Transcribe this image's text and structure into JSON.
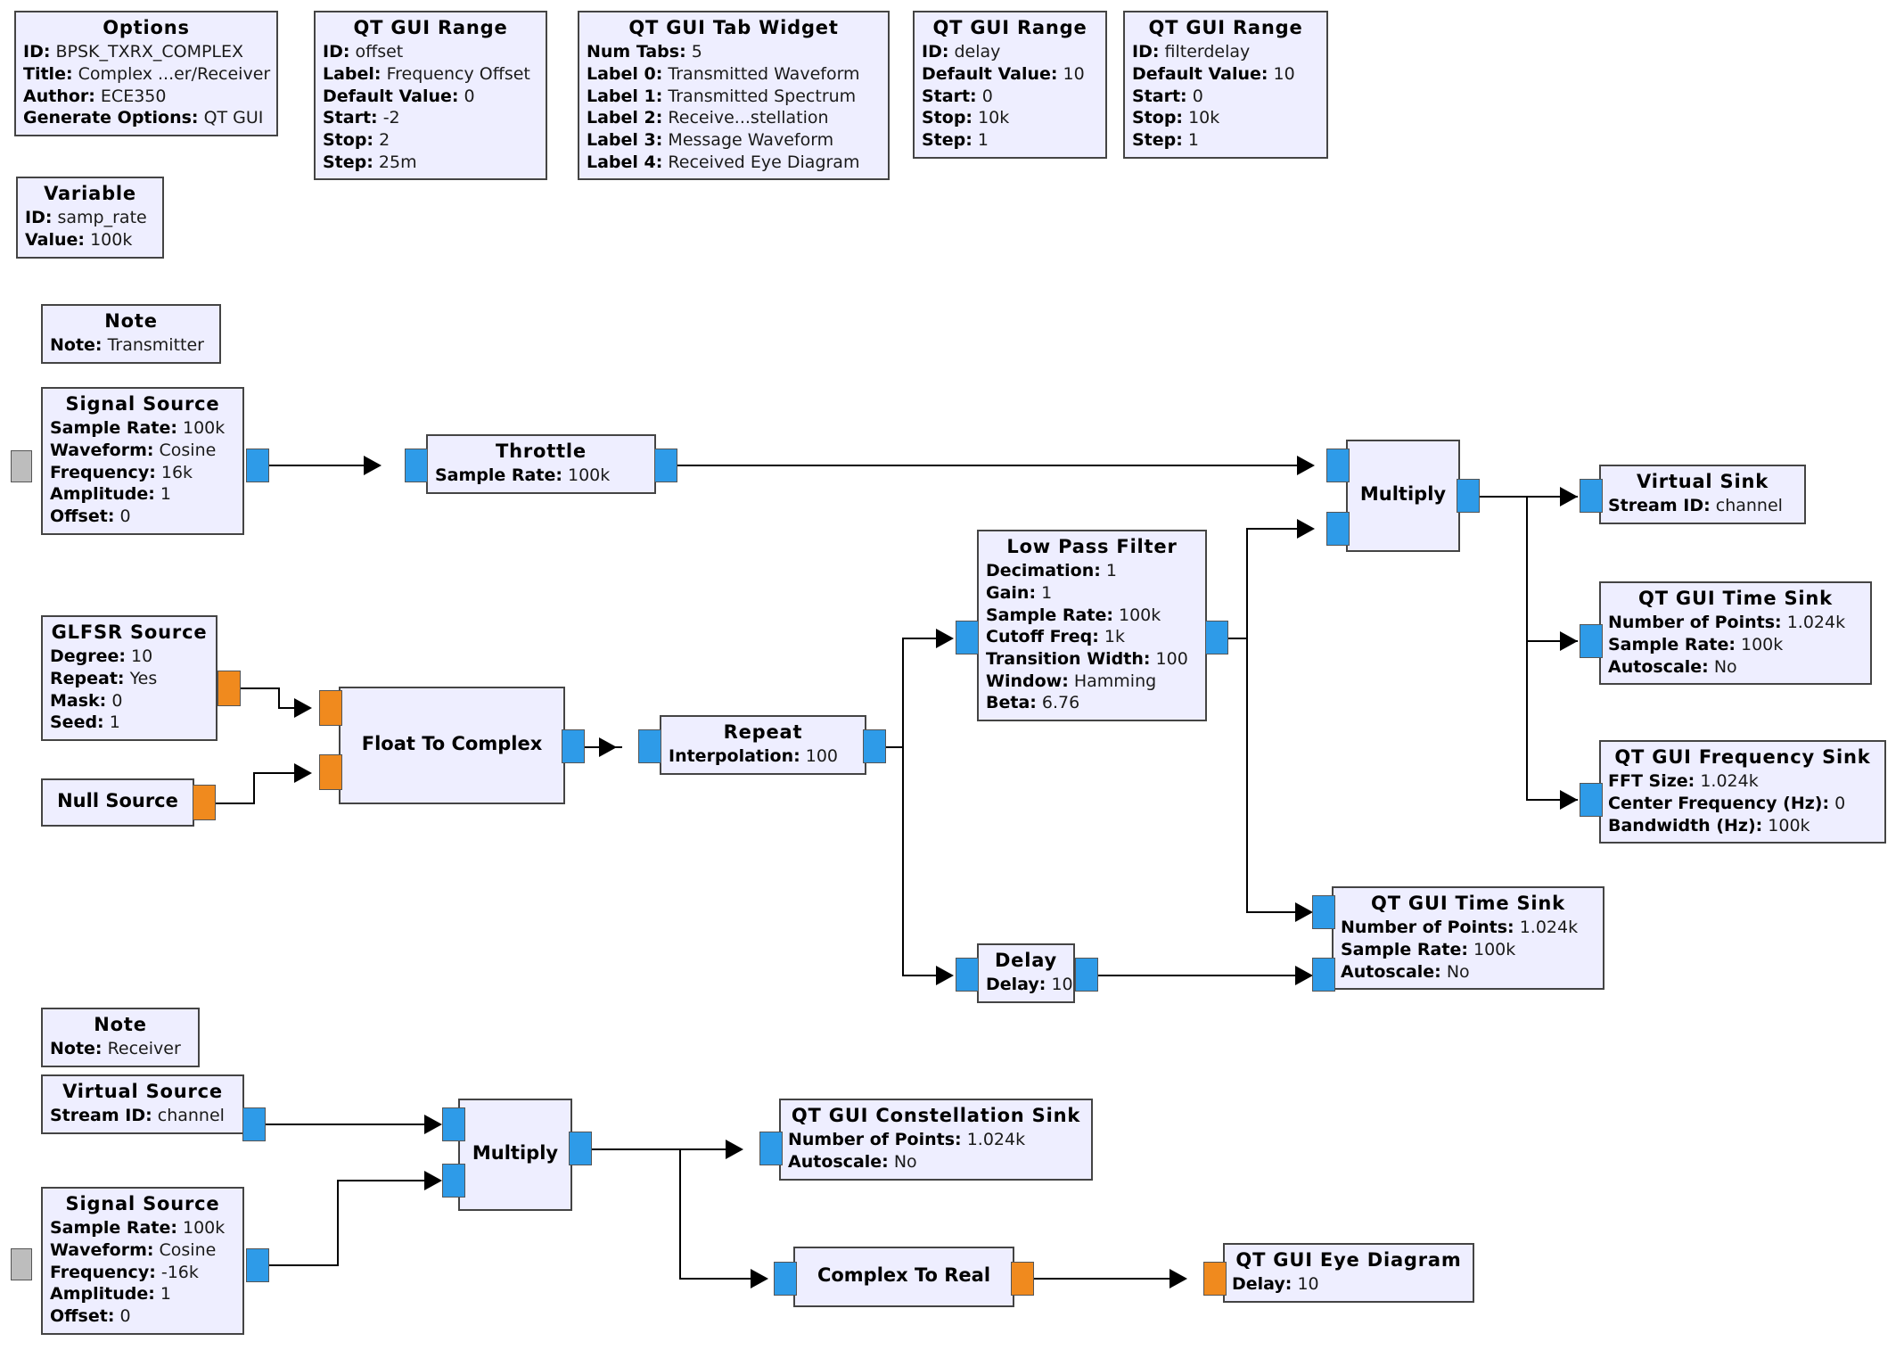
{
  "flowgraph": {
    "blocks": [
      {
        "key": "options",
        "title": "Options",
        "params": [
          {
            "label": "ID:",
            "value": "BPSK_TXRX_COMPLEX"
          },
          {
            "label": "Title:",
            "value": "Complex ...er/Receiver"
          },
          {
            "label": "Author:",
            "value": "ECE350"
          },
          {
            "label": "Generate Options:",
            "value": "QT GUI"
          }
        ]
      },
      {
        "key": "range-offset",
        "title": "QT GUI Range",
        "params": [
          {
            "label": "ID:",
            "value": "offset"
          },
          {
            "label": "Label:",
            "value": "Frequency Offset"
          },
          {
            "label": "Default Value:",
            "value": "0"
          },
          {
            "label": "Start:",
            "value": "-2"
          },
          {
            "label": "Stop:",
            "value": "2"
          },
          {
            "label": "Step:",
            "value": "25m"
          }
        ]
      },
      {
        "key": "tab-widget",
        "title": "QT GUI Tab Widget",
        "params": [
          {
            "label": "Num Tabs:",
            "value": "5"
          },
          {
            "label": "Label 0:",
            "value": "Transmitted Waveform"
          },
          {
            "label": "Label 1:",
            "value": "Transmitted Spectrum"
          },
          {
            "label": "Label 2:",
            "value": "Receive...stellation"
          },
          {
            "label": "Label 3:",
            "value": "Message Waveform"
          },
          {
            "label": "Label 4:",
            "value": "Received Eye Diagram"
          }
        ]
      },
      {
        "key": "range-delay",
        "title": "QT GUI Range",
        "params": [
          {
            "label": "ID:",
            "value": "delay"
          },
          {
            "label": "Default Value:",
            "value": "10"
          },
          {
            "label": "Start:",
            "value": "0"
          },
          {
            "label": "Stop:",
            "value": "10k"
          },
          {
            "label": "Step:",
            "value": "1"
          }
        ]
      },
      {
        "key": "range-filterdelay",
        "title": "QT GUI Range",
        "params": [
          {
            "label": "ID:",
            "value": "filterdelay"
          },
          {
            "label": "Default Value:",
            "value": "10"
          },
          {
            "label": "Start:",
            "value": "0"
          },
          {
            "label": "Stop:",
            "value": "10k"
          },
          {
            "label": "Step:",
            "value": "1"
          }
        ]
      },
      {
        "key": "variable",
        "title": "Variable",
        "params": [
          {
            "label": "ID:",
            "value": "samp_rate"
          },
          {
            "label": "Value:",
            "value": "100k"
          }
        ]
      },
      {
        "key": "note-transmitter",
        "title": "Note",
        "params": [
          {
            "label": "Note:",
            "value": "Transmitter"
          }
        ]
      },
      {
        "key": "signal-source-tx",
        "title": "Signal Source",
        "params": [
          {
            "label": "Sample Rate:",
            "value": "100k"
          },
          {
            "label": "Waveform:",
            "value": "Cosine"
          },
          {
            "label": "Frequency:",
            "value": "16k"
          },
          {
            "label": "Amplitude:",
            "value": "1"
          },
          {
            "label": "Offset:",
            "value": "0"
          }
        ]
      },
      {
        "key": "throttle",
        "title": "Throttle",
        "params": [
          {
            "label": "Sample Rate:",
            "value": "100k"
          }
        ]
      },
      {
        "key": "glfsr-source",
        "title": "GLFSR Source",
        "params": [
          {
            "label": "Degree:",
            "value": "10"
          },
          {
            "label": "Repeat:",
            "value": "Yes"
          },
          {
            "label": "Mask:",
            "value": "0"
          },
          {
            "label": "Seed:",
            "value": "1"
          }
        ]
      },
      {
        "key": "null-source",
        "title": "Null Source",
        "params": []
      },
      {
        "key": "float-to-complex",
        "title": "Float To Complex",
        "params": []
      },
      {
        "key": "repeat",
        "title": "Repeat",
        "params": [
          {
            "label": "Interpolation:",
            "value": "100"
          }
        ]
      },
      {
        "key": "low-pass-filter",
        "title": "Low Pass Filter",
        "params": [
          {
            "label": "Decimation:",
            "value": "1"
          },
          {
            "label": "Gain:",
            "value": "1"
          },
          {
            "label": "Sample Rate:",
            "value": "100k"
          },
          {
            "label": "Cutoff Freq:",
            "value": "1k"
          },
          {
            "label": "Transition Width:",
            "value": "100"
          },
          {
            "label": "Window:",
            "value": "Hamming"
          },
          {
            "label": "Beta:",
            "value": "6.76"
          }
        ]
      },
      {
        "key": "multiply-tx",
        "title": "Multiply",
        "params": []
      },
      {
        "key": "virtual-sink",
        "title": "Virtual Sink",
        "params": [
          {
            "label": "Stream ID:",
            "value": "channel"
          }
        ]
      },
      {
        "key": "time-sink-tx",
        "title": "QT GUI Time Sink",
        "params": [
          {
            "label": "Number of Points:",
            "value": "1.024k"
          },
          {
            "label": "Sample Rate:",
            "value": "100k"
          },
          {
            "label": "Autoscale:",
            "value": "No"
          }
        ]
      },
      {
        "key": "frequency-sink",
        "title": "QT GUI Frequency Sink",
        "params": [
          {
            "label": "FFT Size:",
            "value": "1.024k"
          },
          {
            "label": "Center Frequency (Hz):",
            "value": "0"
          },
          {
            "label": "Bandwidth (Hz):",
            "value": "100k"
          }
        ]
      },
      {
        "key": "delay",
        "title": "Delay",
        "params": [
          {
            "label": "Delay:",
            "value": "10"
          }
        ]
      },
      {
        "key": "time-sink-msg",
        "title": "QT GUI Time Sink",
        "params": [
          {
            "label": "Number of Points:",
            "value": "1.024k"
          },
          {
            "label": "Sample Rate:",
            "value": "100k"
          },
          {
            "label": "Autoscale:",
            "value": "No"
          }
        ]
      },
      {
        "key": "note-receiver",
        "title": "Note",
        "params": [
          {
            "label": "Note:",
            "value": "Receiver"
          }
        ]
      },
      {
        "key": "virtual-source",
        "title": "Virtual Source",
        "params": [
          {
            "label": "Stream ID:",
            "value": "channel"
          }
        ]
      },
      {
        "key": "signal-source-rx",
        "title": "Signal Source",
        "params": [
          {
            "label": "Sample Rate:",
            "value": "100k"
          },
          {
            "label": "Waveform:",
            "value": "Cosine"
          },
          {
            "label": "Frequency:",
            "value": "-16k"
          },
          {
            "label": "Amplitude:",
            "value": "1"
          },
          {
            "label": "Offset:",
            "value": "0"
          }
        ]
      },
      {
        "key": "multiply-rx",
        "title": "Multiply",
        "params": []
      },
      {
        "key": "constellation-sink",
        "title": "QT GUI Constellation Sink",
        "params": [
          {
            "label": "Number of Points:",
            "value": "1.024k"
          },
          {
            "label": "Autoscale:",
            "value": "No"
          }
        ]
      },
      {
        "key": "complex-to-real",
        "title": "Complex To Real",
        "params": []
      },
      {
        "key": "eye-diagram",
        "title": "QT GUI Eye Diagram",
        "params": [
          {
            "label": "Delay:",
            "value": "10"
          }
        ]
      }
    ]
  }
}
